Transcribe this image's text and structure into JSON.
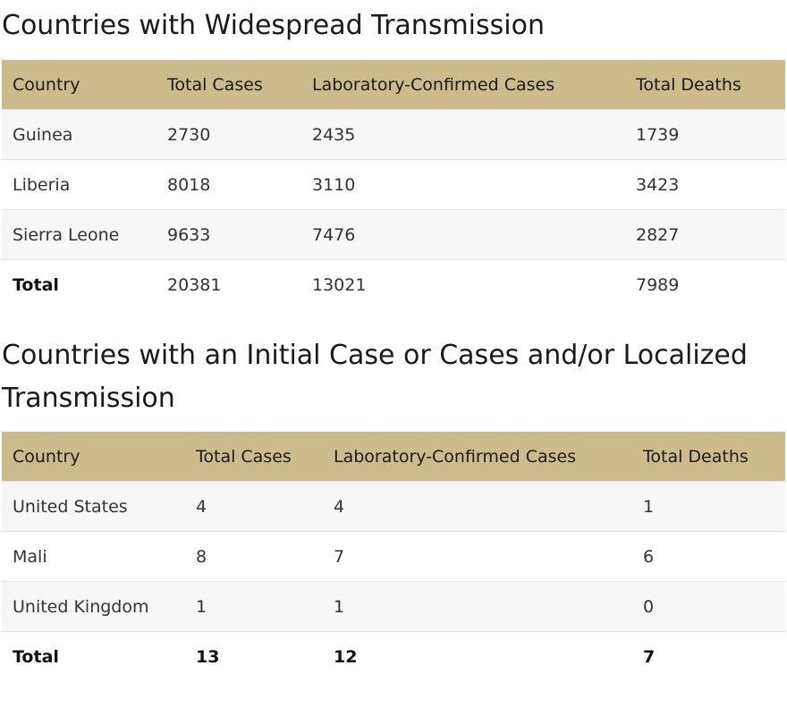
{
  "widespread": {
    "title": "Countries with Widespread Transmission",
    "headers": [
      "Country",
      "Total Cases",
      "Laboratory-Confirmed Cases",
      "Total Deaths"
    ],
    "rows": [
      [
        "Guinea",
        "2730",
        "2435",
        "1739"
      ],
      [
        "Liberia",
        "8018",
        "3110",
        "3423"
      ],
      [
        "Sierra Leone",
        "9633",
        "7476",
        "2827"
      ]
    ],
    "total": [
      "Total",
      "20381",
      "13021",
      "7989"
    ]
  },
  "localized": {
    "title": "Countries with an Initial Case or Cases and/or Localized Transmission",
    "headers": [
      "Country",
      "Total Cases",
      "Laboratory-Confirmed Cases",
      "Total Deaths"
    ],
    "rows": [
      [
        "United States",
        "4",
        "4",
        "1"
      ],
      [
        "Mali",
        "8",
        "7",
        "6"
      ],
      [
        "United Kingdom",
        "1",
        "1",
        "0"
      ]
    ],
    "total": [
      "Total",
      "13",
      "12",
      "7"
    ]
  }
}
